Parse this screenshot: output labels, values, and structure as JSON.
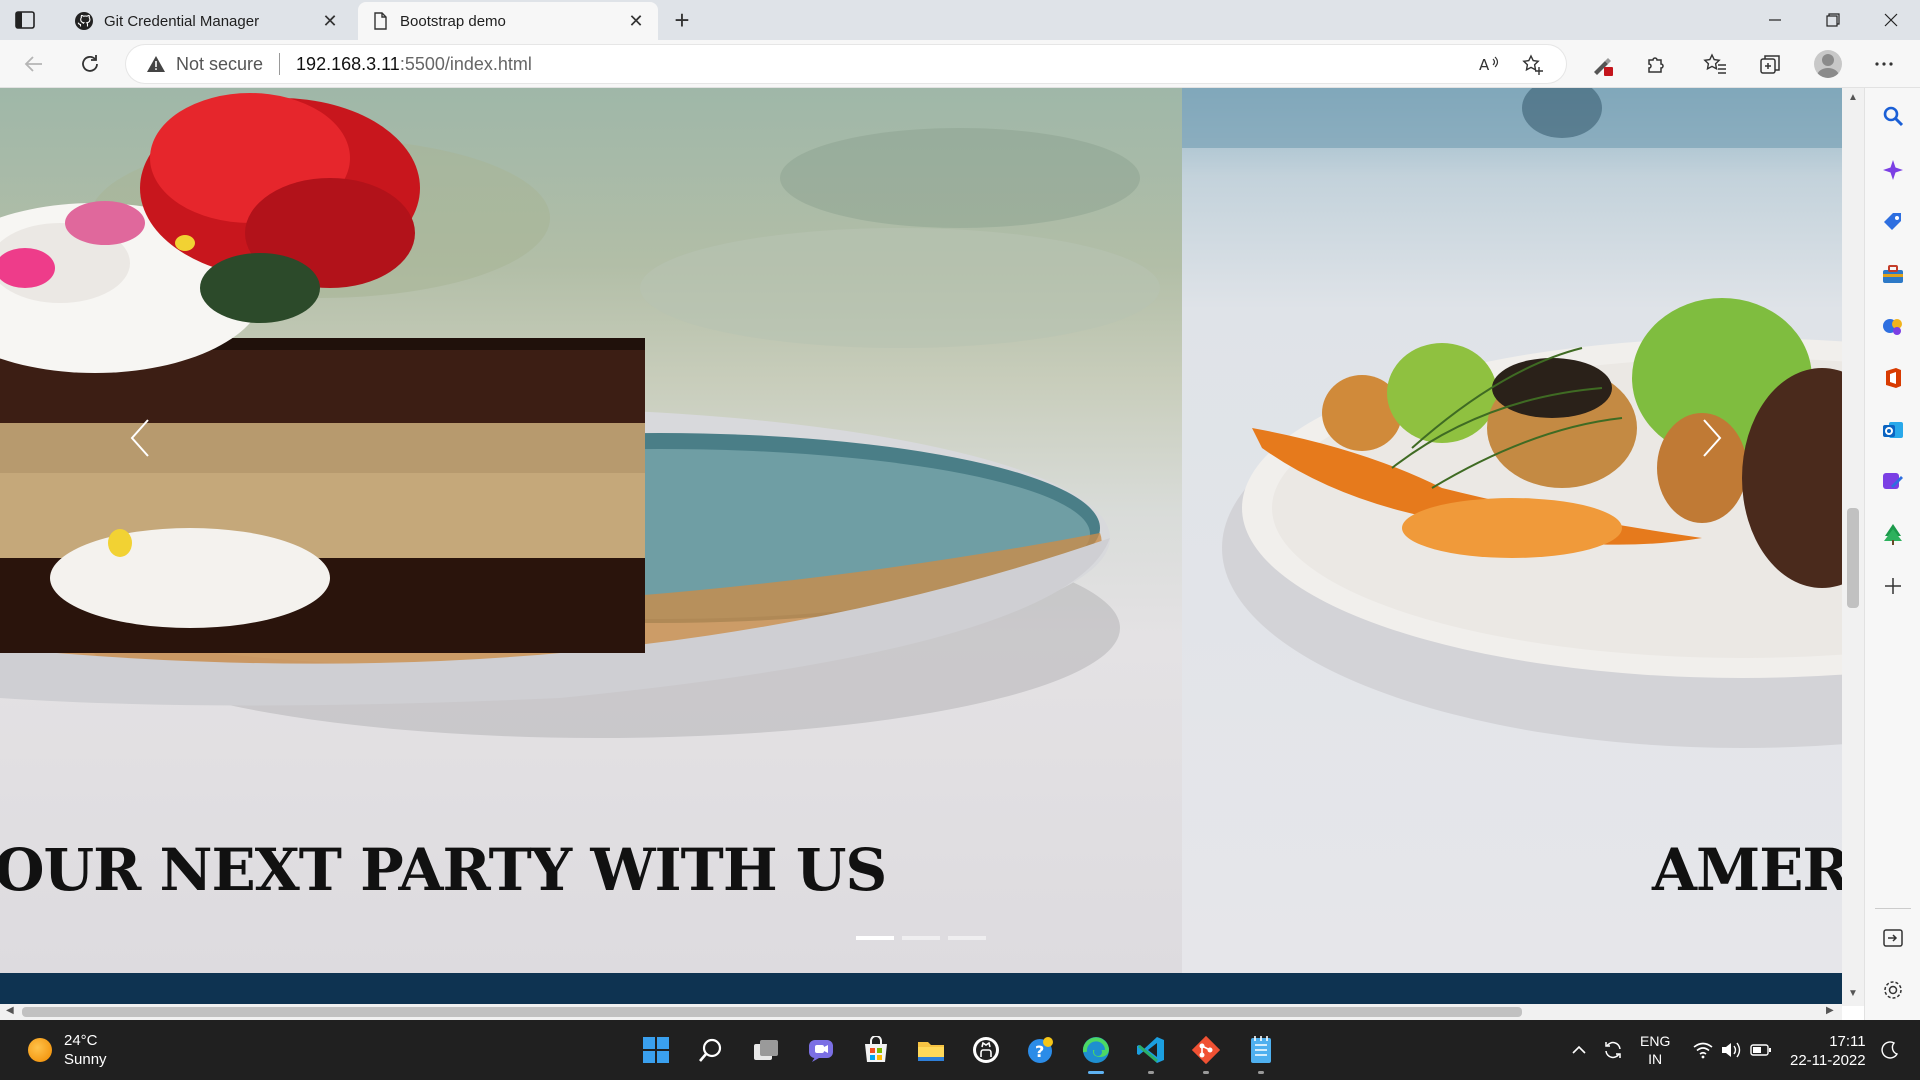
{
  "browser": {
    "tabs": [
      {
        "title": "Git Credential Manager",
        "icon": "github-icon",
        "active": false
      },
      {
        "title": "Bootstrap demo",
        "icon": "page-icon",
        "active": true
      }
    ],
    "new_tab_symbol": "+",
    "address": {
      "security_label": "Not secure",
      "host": "192.168.3.11",
      "path": ":5500/index.html"
    }
  },
  "page": {
    "carousel": {
      "slides": [
        {
          "caption": "OUR NEXT PARTY WITH US",
          "image": "chocolate-cake-with-rose-on-blue-plate"
        },
        {
          "caption": "AMERIC",
          "image": "scallops-and-greens-on-white-plate"
        }
      ],
      "indicator_count": 3,
      "active_index": 0
    },
    "colors": {
      "nav_band": "#0e3351"
    }
  },
  "taskbar": {
    "weather": {
      "temp": "24°C",
      "condition": "Sunny"
    },
    "language": {
      "line1": "ENG",
      "line2": "IN"
    },
    "clock": {
      "time": "17:11",
      "date": "22-11-2022"
    }
  }
}
